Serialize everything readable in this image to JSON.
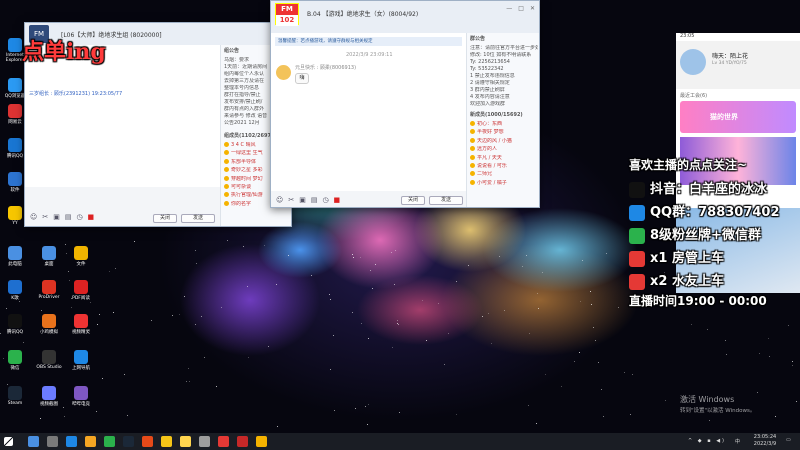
{
  "overlay": {
    "order_title": "点单ing",
    "promo_header": "喜欢主播的点点关注~",
    "lines": [
      {
        "icon": "tiktok-icon",
        "text": "抖音：白羊座的冰冰"
      },
      {
        "icon": "qq-icon",
        "text": "QQ群：788307402"
      },
      {
        "icon": "wechat-icon",
        "text": "8级粉丝牌+微信群"
      },
      {
        "icon": "car-icon",
        "text": "x1 房管上车"
      },
      {
        "icon": "car-icon",
        "text": "x2 水友上车"
      }
    ],
    "live_time": "直播时间19:00 - 00:00"
  },
  "window_left": {
    "title": "[L06【大师】绝地求生组 (8020000]",
    "logo": "FM",
    "msg_name": "三岁组长 : 顾乐(2391231) 19:23:05/77",
    "sidebar_heading": "组公告",
    "sidebar_lines": [
      "乌烟：要求",
      "1天前：近期请房间",
      "组内每位个人永认",
      "去掉第三方及请在",
      "整理本号内信息",
      "群打在指导/禁止",
      "发布安排/禁止刷/",
      "群内有点的入群外",
      "来请参与 修改 语音",
      "公告2021 12月"
    ],
    "members_heading": "组成员(1102/2697)",
    "members": [
      "3 4 C 晴风",
      "一绿这里 生气",
      "东部半导体",
      "奇妙之星 多彩",
      "穿越时间 梦幻",
      "可可杂谈",
      "执行官理/仙游",
      "你的名字"
    ],
    "btn_close": "关闭",
    "btn_send": "发送"
  },
  "window_mid": {
    "title": "B.04 【游戏】绝地求生（女）(8004/92)",
    "logo": "FM",
    "logo_num": "102",
    "notice": "温馨提醒：若点播游戏，请遵守群规与相关规定",
    "timestamp": "2022/3/9 23:09:11",
    "msg_head": "元旦快乐 : 顾柔(8006913)",
    "bubble": "嗨",
    "sidebar_heading": "群公告",
    "sidebar_lines": [
      "注意：请前往官方平台进一步处理",
      "修改: 10位 如有不明请联系",
      "Ty: 2256213654",
      "Ty: 53522342",
      "1 禁止发布违规信息",
      "2 请遵守相关规定",
      "3 群内禁止刷屏",
      "4 发布内容请注意",
      "欢迎加入游戏群"
    ],
    "members_heading": "新成员(1000/15692)",
    "members": [
      "初心：东西",
      "半夜好 梦想",
      "天边的风 / 小猫",
      "远方的人",
      "平凡 / 天天",
      "说说看 / 可乐",
      "二师兄",
      "小可爱 / 橘子"
    ],
    "btn_close": "关闭",
    "btn_send": "发送"
  },
  "phone": {
    "status_time": "23:05",
    "profile_name": "嗨天：陌上花",
    "profile_sub": "Lv 34 YD/YO/75",
    "section_label": "最近工会(6)",
    "banner_text": "猫的世界"
  },
  "watermark": {
    "line1": "激活 Windows",
    "line2": "转到\"设置\"以激活 Windows。"
  },
  "desktop_icons": [
    {
      "label": "Internet Explorer",
      "color": "#1e88e5"
    },
    {
      "label": "QQ浏览器",
      "color": "#2b9af3"
    },
    {
      "label": "网易云",
      "color": "#d33"
    },
    {
      "label": "腾讯QQ",
      "color": "#1976d2"
    },
    {
      "label": "软件",
      "color": "#2d74d0"
    },
    {
      "label": "YY",
      "color": "#f7c600"
    },
    {
      "label": "此电脑",
      "color": "#4a90e2"
    },
    {
      "label": "K歌",
      "color": "#1e6fd0"
    },
    {
      "label": "腾讯QQ",
      "color": "#111"
    },
    {
      "label": "微信",
      "color": "#2bb24c"
    },
    {
      "label": "Steam",
      "color": "#1b2838"
    },
    {
      "label": "桌面",
      "color": "#4a90e2"
    },
    {
      "label": "ProDriver",
      "color": "#d32"
    },
    {
      "label": "小鸡模拟",
      "color": "#e8721c"
    },
    {
      "label": "OBS Studio",
      "color": "#333"
    },
    {
      "label": "视频截图",
      "color": "#6b7cff"
    },
    {
      "label": "文件",
      "color": "#f0b400"
    },
    {
      "label": "PDF阅读",
      "color": "#d22"
    },
    {
      "label": "视频精灵",
      "color": "#e33"
    },
    {
      "label": "上网导航",
      "color": "#1e88e5"
    },
    {
      "label": "哔哔电竞",
      "color": "#7e57c2"
    }
  ],
  "taskbar": {
    "time": "23:05:24",
    "date": "2022/3/9",
    "lang": "中"
  }
}
